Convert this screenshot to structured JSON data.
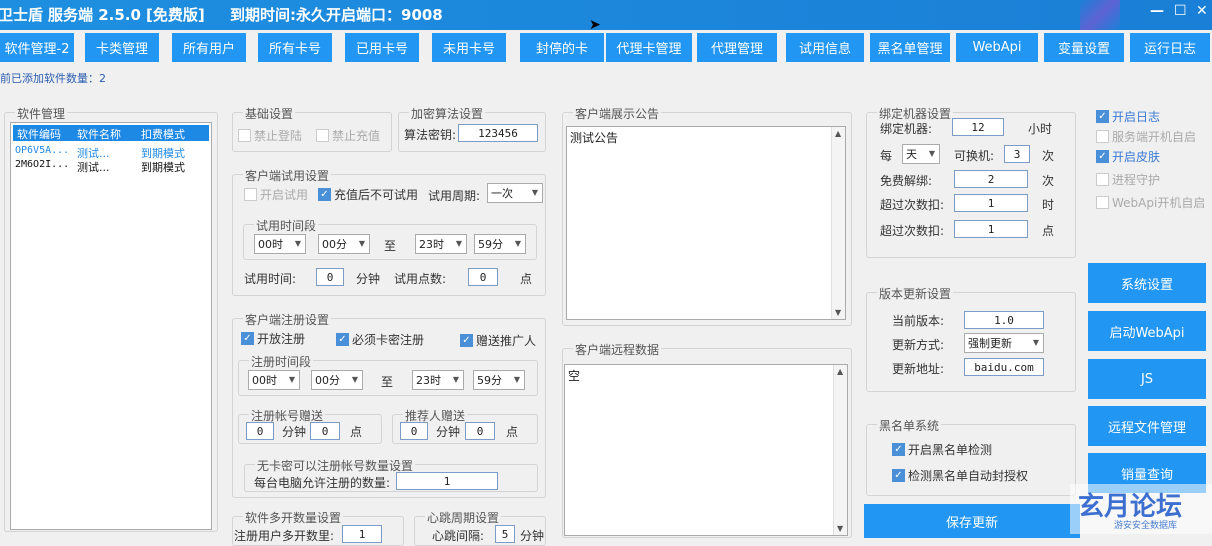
{
  "titlebar": {
    "app": "卫士盾",
    "service": "服务端 2.5.0",
    "edition": "[免费版]",
    "expire": "到期时间:永久",
    "port": "开启端口：9008",
    "min": "—",
    "max": "☐",
    "close": "✕"
  },
  "nav": [
    "软件管理-2",
    "卡类管理",
    "所有用户",
    "所有卡号",
    "已用卡号",
    "未用卡号",
    "封停的卡",
    "代理卡管理",
    "代理管理",
    "试用信息",
    "黑名单管理",
    "WebApi",
    "变量设置",
    "运行日志"
  ],
  "count_label": "前已添加软件数量：2",
  "software": {
    "legend": "软件管理",
    "headers": [
      "软件编码",
      "软件名称",
      "扣费模式"
    ],
    "rows": [
      [
        "OP6V5A...",
        "测试...",
        "到期模式"
      ],
      [
        "2M6O2I...",
        "测试...",
        "到期模式"
      ]
    ]
  },
  "basic": {
    "legend": "基础设置",
    "forbid_login": "禁止登陆",
    "forbid_recharge": "禁止充值"
  },
  "encrypt": {
    "legend": "加密算法设置",
    "key_label": "算法密钥:",
    "key_value": "123456"
  },
  "trial": {
    "legend": "客户端试用设置",
    "enable": "开启试用",
    "after_recharge": "充值后不可试用",
    "cycle_label": "试用周期:",
    "cycle_value": "一次",
    "period_legend": "试用时间段",
    "h1": "00时",
    "m1": "00分",
    "to": "至",
    "h2": "23时",
    "m2": "59分",
    "time_label": "试用时间:",
    "time_value": "0",
    "minute": "分钟",
    "points_label": "试用点数:",
    "points_value": "0",
    "point_unit": "点"
  },
  "register": {
    "legend": "客户端注册设置",
    "open": "开放注册",
    "need_card": "必须卡密注册",
    "gift_referrer": "赠送推广人",
    "period_legend": "注册时间段",
    "h1": "00时",
    "m1": "00分",
    "to": "至",
    "h2": "23时",
    "m2": "59分",
    "gift_legend": "注册帐号赠送",
    "gift_min": "0",
    "minute": "分钟",
    "gift_pt": "0",
    "point": "点",
    "ref_legend": "推荐人赠送",
    "ref_min": "0",
    "ref_pt": "0",
    "nocard_legend": "无卡密可以注册帐号数量设置",
    "per_pc_label": "每台电脑允许注册的数量:",
    "per_pc_value": "1"
  },
  "multi": {
    "legend": "软件多开数量设置",
    "label": "注册用户多开数里:",
    "value": "1"
  },
  "heartbeat": {
    "legend": "心跳周期设置",
    "label": "心跳间隔:",
    "value": "5",
    "unit": "分钟"
  },
  "notice": {
    "legend": "客户端展示公告",
    "text": "测试公告"
  },
  "remote": {
    "legend": "客户端远程数据",
    "text": "空"
  },
  "bind": {
    "legend": "绑定机器设置",
    "bind_label": "绑定机器:",
    "bind_value": "12",
    "hour": "小时",
    "every": "每",
    "day": "天",
    "change_label": "可换机:",
    "change_value": "3",
    "times": "次",
    "free_label": "免费解绑:",
    "free_value": "2",
    "over1_label": "超过次数扣:",
    "over1_value": "1",
    "over1_unit": "时",
    "over2_label": "超过次数扣:",
    "over2_value": "1",
    "over2_unit": "点"
  },
  "version": {
    "legend": "版本更新设置",
    "cur_label": "当前版本:",
    "cur_value": "1.0",
    "mode_label": "更新方式:",
    "mode_value": "强制更新",
    "url_label": "更新地址:",
    "url_value": "baidu.com"
  },
  "blacklist": {
    "legend": "黑名单系统",
    "detect": "开启黑名单检测",
    "auto_ban": "检测黑名单自动封授权"
  },
  "options": {
    "log": "开启日志",
    "autostart": "服务端开机自启",
    "skin": "开启皮肤",
    "guard": "进程守护",
    "webapi_boot": "WebApi开机自启"
  },
  "buttons": {
    "system": "系统设置",
    "webapi": "启动WebApi",
    "js": "JS",
    "remote_file": "远程文件管理",
    "sales": "销量查询",
    "save": "保存更新"
  },
  "watermark": {
    "text": "玄月论坛",
    "sub": "游安安全数据库"
  }
}
